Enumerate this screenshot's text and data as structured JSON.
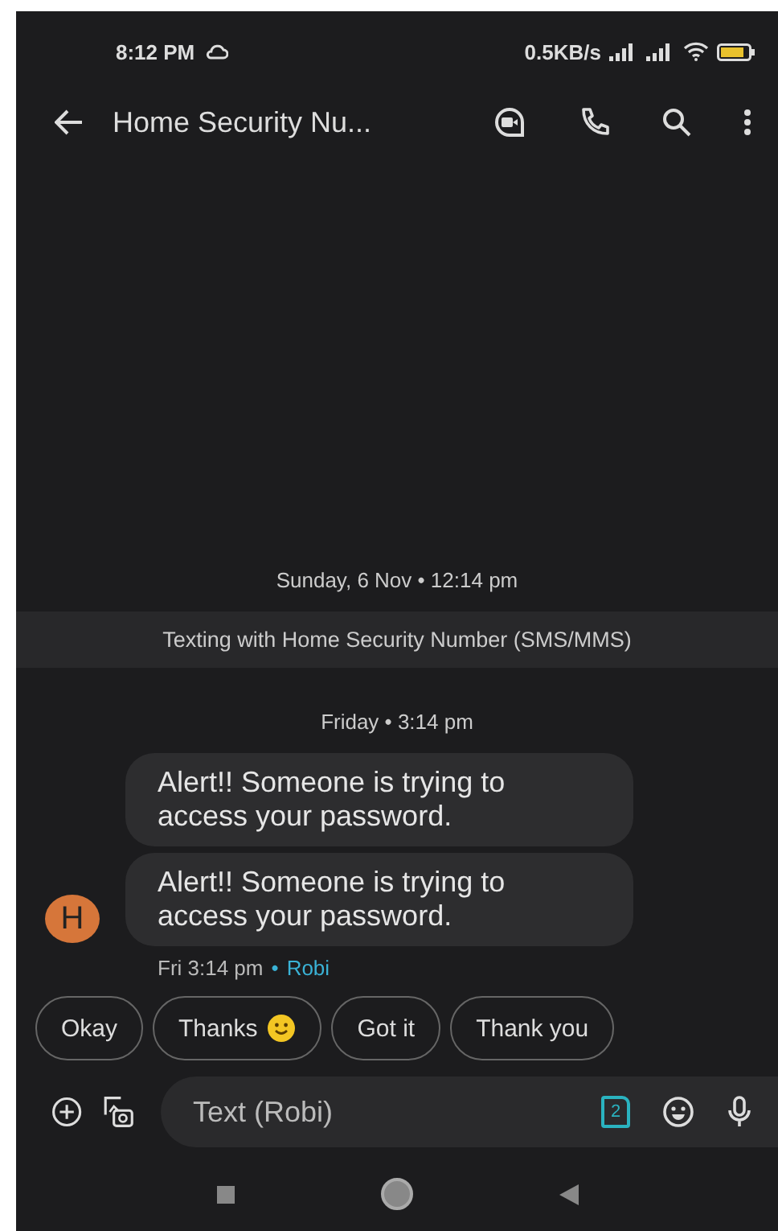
{
  "status_bar": {
    "time": "8:12 PM",
    "net_speed": "0.5KB/s"
  },
  "app_bar": {
    "title": "Home Security Nu..."
  },
  "conversation": {
    "date_header": "Sunday, 6 Nov • 12:14 pm",
    "banner": "Texting with Home Security Number (SMS/MMS)",
    "time_header": "Friday • 3:14 pm",
    "messages": [
      {
        "text": "Alert!! Someone is trying to access your password."
      },
      {
        "text": "Alert!! Someone is trying to access your password."
      }
    ],
    "avatar_letter": "H",
    "meta_time": "Fri 3:14 pm",
    "meta_separator": "•",
    "meta_sender": "Robi"
  },
  "smart_replies": [
    {
      "label": "Okay",
      "emoji": false
    },
    {
      "label": "Thanks",
      "emoji": true
    },
    {
      "label": "Got it",
      "emoji": false
    },
    {
      "label": "Thank you",
      "emoji": false
    }
  ],
  "composer": {
    "placeholder": "Text (Robi)",
    "sim_label": "2"
  }
}
